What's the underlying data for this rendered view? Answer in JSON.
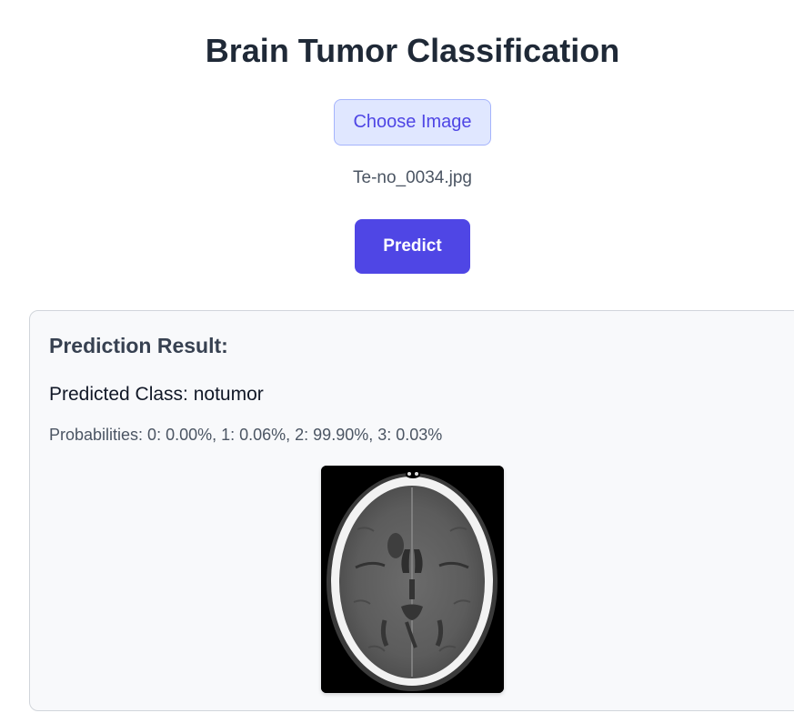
{
  "page": {
    "title": "Brain Tumor Classification"
  },
  "upload": {
    "choose_label": "Choose Image",
    "filename": "Te-no_0034.jpg"
  },
  "actions": {
    "predict_label": "Predict"
  },
  "result": {
    "heading": "Prediction Result:",
    "predicted_class": "Predicted Class: notumor",
    "probabilities": "Probabilities: 0: 0.00%, 1: 0.06%, 2: 99.90%, 3: 0.03%"
  },
  "colors": {
    "accent": "#4f46e5",
    "accent_light": "#e0e7ff",
    "card_background": "#f8f9fb"
  }
}
